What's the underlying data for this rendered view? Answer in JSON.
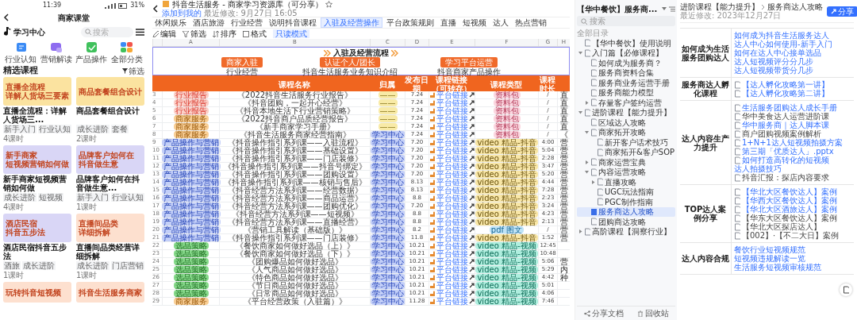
{
  "phone": {
    "status_time": "11:39",
    "battery": "31%",
    "title": "商家课堂",
    "logo": "学习中心",
    "search_placeholder": "搜索",
    "categories": [
      {
        "label": "行业认知",
        "kind": "flag"
      },
      {
        "label": "营销解读",
        "kind": "chat"
      },
      {
        "label": "产品操作",
        "kind": "check"
      },
      {
        "label": "全部分类",
        "kind": "grid"
      }
    ],
    "section_title": "精选课程",
    "filter": "筛选",
    "courses": [
      {
        "banner": [
          "直播全流程",
          "详解人货场三要素"
        ],
        "color": "#fbe3a0",
        "title": "直播全流程：详解人货场三...",
        "tags": [
          "新手入门",
          "行业认知"
        ],
        "lessons": "4课时"
      },
      {
        "banner": [
          "商品套餐组合设计"
        ],
        "color": "#fbe3a0",
        "title": "商品套餐组合设计",
        "tags": [
          "成长进阶",
          "套餐"
        ],
        "lessons": "2课时"
      },
      {
        "banner": [
          "新手商家",
          "短视频营销如何做"
        ],
        "color": "#d9d6f6",
        "title": "新手商家短视频营销如何做",
        "tags": [
          "成长进阶",
          "短视频"
        ],
        "lessons": "4课时"
      },
      {
        "banner": [
          "品牌客户如何在",
          "抖音做生意"
        ],
        "color": "#d9d6f6",
        "title": "品牌客户如何在抖音做生意...",
        "tags": [
          "新手入门",
          "行业认知"
        ],
        "lessons": "1课时"
      },
      {
        "banner": [
          "酒店民宿",
          "抖音五步法"
        ],
        "color": "#d9d6f6",
        "title": "酒店民宿抖音五步法",
        "tags": [
          "酒旅",
          "成长进阶"
        ],
        "lessons": "1课时"
      },
      {
        "banner": [
          "直播间品类",
          "详细拆解"
        ],
        "color": "#fde0cf",
        "title": "直播间品类经营详细拆解",
        "tags": [
          "成长进阶",
          "门店营销"
        ],
        "lessons": "1课时"
      }
    ],
    "more_courses": [
      {
        "banner": [
          "玩转抖音短视频"
        ],
        "color": "#fde0cf"
      },
      {
        "banner": [
          "抖音生活服务商家"
        ],
        "color": "#fde0cf"
      }
    ]
  },
  "sheet": {
    "title": "抖音生活服务 - 商家学习资源库（可分享）",
    "add_link": "添加到我的",
    "modified": "最近修改: 9月27日 16:05",
    "tabs": [
      {
        "label": "休闲娱乐",
        "selected": false
      },
      {
        "label": "酒店旅游",
        "selected": false
      },
      {
        "label": "行业经营",
        "selected": false
      },
      {
        "label": "说明抖音课程",
        "selected": false
      },
      {
        "label": "入驻及经营操作",
        "selected": true
      },
      {
        "label": "平台政策规则",
        "selected": false
      },
      {
        "label": "直播",
        "selected": false
      },
      {
        "label": "短视频",
        "selected": false
      },
      {
        "label": "达人",
        "selected": false
      },
      {
        "label": "热点营销",
        "selected": false
      }
    ],
    "toolbar": [
      "编辑",
      "筛选",
      "排序",
      "格式"
    ],
    "mode": "只读模式",
    "column_letters": [
      "A",
      "B",
      "C",
      "D",
      "E",
      "F",
      "G",
      "H"
    ],
    "flow": {
      "title": "入驻及经营流程",
      "steps": [
        {
          "label": "商家入驻",
          "caption": "行业经营"
        },
        {
          "label": "认证个人/团长",
          "caption": "抖音生活服务业务知识介绍"
        },
        {
          "label": "学习平台运营",
          "caption": "抖音商家产品操作"
        }
      ]
    },
    "columns": [
      "课程名称",
      "归属",
      "发布日期",
      "课程链接（可转存）",
      "课程类型",
      "课程时长"
    ],
    "rows": [
      {
        "num": "3",
        "category": {
          "label": "行业报告",
          "kind": "report"
        },
        "title": "《2022抖音生活服务行业报告》",
        "source": {
          "label": "——",
          "kind": "dash"
        },
        "date": "7.24",
        "link": "平台链接",
        "type": {
          "label": "资料包",
          "kind": "pack"
        },
        "duration": "/",
        "extra": "直"
      },
      {
        "num": "4",
        "category": {
          "label": "行业报告",
          "kind": "report"
        },
        "title": "《抖音团购，一起开心经营》",
        "source": {
          "label": "——",
          "kind": "dash"
        },
        "date": "7.24",
        "link": "平台链接",
        "type": {
          "label": "资料包",
          "kind": "pack"
        },
        "duration": "/",
        "extra": "直"
      },
      {
        "num": "5",
        "category": {
          "label": "行业报告",
          "kind": "report"
        },
        "title": "《抖音本地生活下行业营销策略》",
        "source": {
          "label": "——",
          "kind": "dash"
        },
        "date": "7.24",
        "link": "平台链接",
        "type": {
          "label": "资料包",
          "kind": "pack"
        },
        "duration": "/",
        "extra": "直"
      },
      {
        "num": "6",
        "category": {
          "label": "商家服务",
          "kind": "service"
        },
        "title": "《2022抖音商户品质经营报告》",
        "source": {
          "label": "——",
          "kind": "dash"
        },
        "date": "7.24",
        "link": "平台链接",
        "type": {
          "label": "资料包",
          "kind": "pack"
        },
        "duration": "/",
        "extra": "直"
      },
      {
        "num": "7",
        "category": {
          "label": "商家服务",
          "kind": "service"
        },
        "title": "《新手商家学习手册》",
        "source": {
          "label": "——",
          "kind": "dash"
        },
        "date": "7.24",
        "link": "平台链接",
        "type": {
          "label": "资料包",
          "kind": "pack"
        },
        "duration": "/",
        "extra": "直"
      },
      {
        "num": "8",
        "category": {
          "label": "商家服务",
          "kind": "service"
        },
        "title": "《抖音生活服务商家经营指南》",
        "source": {
          "label": "学习中心",
          "kind": "center"
        },
        "date": "7.24",
        "link": "平台链接",
        "type": {
          "label": "资料包",
          "kind": "pack"
        },
        "duration": "/",
        "extra": "《"
      },
      {
        "num": "9",
        "category": {
          "label": "产品操作与营销",
          "kind": "product"
        },
        "title": "《抖音操作指引系列课——入驻流程》",
        "source": {
          "label": "学习中心",
          "kind": "center"
        },
        "date": "7.20",
        "link": "平台链接",
        "type": {
          "label": "video 精品-抖音",
          "kind": "video"
        },
        "duration": "4:00",
        "extra": "营"
      },
      {
        "num": "10",
        "category": {
          "label": "产品操作与营销",
          "kind": "product"
        },
        "title": "《抖音操作指引系列课——基础设置》",
        "source": {
          "label": "学习中心",
          "kind": "center"
        },
        "date": "7.20",
        "link": "平台链接",
        "type": {
          "label": "video 精品-抖音",
          "kind": "video"
        },
        "duration": "5:04",
        "extra": "营"
      },
      {
        "num": "11",
        "category": {
          "label": "产品操作与营销",
          "kind": "product"
        },
        "title": "《抖音操作指引系列课——门店装修》",
        "source": {
          "label": "学习中心",
          "kind": "center"
        },
        "date": "7.20",
        "link": "平台链接",
        "type": {
          "label": "video 精品-抖音",
          "kind": "video"
        },
        "duration": "2:28",
        "extra": "营"
      },
      {
        "num": "12",
        "category": {
          "label": "产品操作与营销",
          "kind": "product"
        },
        "title": "《抖音操作指引系列课——抖音号绑定》",
        "source": {
          "label": "学习中心",
          "kind": "center"
        },
        "date": "7.20",
        "link": "平台链接",
        "type": {
          "label": "video 精品-抖音",
          "kind": "video"
        },
        "duration": "3:47",
        "extra": "营"
      },
      {
        "num": "13",
        "category": {
          "label": "产品操作与营销",
          "kind": "product"
        },
        "title": "《抖音操作指引系列课——团购设置》",
        "source": {
          "label": "学习中心",
          "kind": "center"
        },
        "date": "7.20",
        "link": "平台链接",
        "type": {
          "label": "video 精品-抖音",
          "kind": "video"
        },
        "duration": "5:20",
        "extra": "营"
      },
      {
        "num": "14",
        "category": {
          "label": "产品操作与营销",
          "kind": "product"
        },
        "title": "《抖音操作指引系列课——核销与售后》",
        "source": {
          "label": "学习中心",
          "kind": "center"
        },
        "date": "8.13",
        "link": "平台链接",
        "type": {
          "label": "video 精品-抖音",
          "kind": "video"
        },
        "duration": "4:44",
        "extra": "营"
      },
      {
        "num": "15",
        "category": {
          "label": "产品操作与营销",
          "kind": "product"
        },
        "title": "《抖音经营方法系列课——经营数据》",
        "source": {
          "label": "学习中心",
          "kind": "center"
        },
        "date": "8.13",
        "link": "平台链接",
        "type": {
          "label": "video 精品-抖音",
          "kind": "video"
        },
        "duration": "7:28",
        "extra": "营"
      },
      {
        "num": "16",
        "category": {
          "label": "产品操作与营销",
          "kind": "product"
        },
        "title": "《抖音经营方法系列课——商品运营》",
        "source": {
          "label": "学习中心",
          "kind": "center"
        },
        "date": "8.8",
        "link": "平台链接",
        "type": {
          "label": "video 精品-抖音",
          "kind": "video"
        },
        "duration": "2:23",
        "extra": "营"
      },
      {
        "num": "17",
        "category": {
          "label": "产品操作与营销",
          "kind": "product"
        },
        "title": "《抖音经营方法系列课——团购优化》",
        "source": {
          "label": "学习中心",
          "kind": "center"
        },
        "date": "7.20",
        "link": "平台链接",
        "type": {
          "label": "video 精品-抖音",
          "kind": "video"
        },
        "duration": "3:24",
        "extra": "营"
      },
      {
        "num": "18",
        "category": {
          "label": "产品操作与营销",
          "kind": "product"
        },
        "title": "《抖音经营方法系列课——短视频》",
        "source": {
          "label": "学习中心",
          "kind": "center"
        },
        "date": "8.8",
        "link": "平台链接",
        "type": {
          "label": "video 精品-抖音",
          "kind": "video"
        },
        "duration": "4:23",
        "extra": "营"
      },
      {
        "num": "19",
        "category": {
          "label": "产品操作与营销",
          "kind": "product"
        },
        "title": "《抖音经营方法系列课——直播经营》",
        "source": {
          "label": "学习中心",
          "kind": "center"
        },
        "date": "8.8",
        "link": "平台链接",
        "type": {
          "label": "video 精品-抖音",
          "kind": "video"
        },
        "duration": "2:13",
        "extra": "营"
      },
      {
        "num": "20",
        "category": {
          "label": "产品操作与营销",
          "kind": "product"
        },
        "title": "《营销工具解读（基础版）》",
        "source": {
          "label": "学习中心",
          "kind": "center"
        },
        "date": "8.2",
        "link": "平台链接",
        "type": {
          "label": "pdf 图文",
          "kind": "pdf"
        },
        "duration": "/",
        "extra": "营"
      },
      {
        "num": "21",
        "category": {
          "label": "产品操作与营销",
          "kind": "product"
        },
        "title": "《抖音操作指引系列课——门店装修》",
        "source": {
          "label": "学习中心",
          "kind": "center"
        },
        "date": "11.8",
        "link": "平台链接",
        "type": {
          "label": "video 精品-抖音",
          "kind": "video"
        },
        "duration": "1:52",
        "extra": "营"
      },
      {
        "num": "22",
        "category": {
          "label": "选品策略",
          "kind": "select"
        },
        "title": "《餐饮商家如何做好选品（上）》",
        "source": {
          "label": "学习中心",
          "kind": "center"
        },
        "date": "10.21",
        "link": "平台链接",
        "type": {
          "label": "video 精品-视频",
          "kind": "video2"
        },
        "duration": "12:45"
      },
      {
        "num": "23",
        "category": {
          "label": "选品策略",
          "kind": "select"
        },
        "title": "《餐饮商家如何做好选品（下）》",
        "source": {
          "label": "学习中心",
          "kind": "center"
        },
        "date": "10.21",
        "link": "平台链接",
        "type": {
          "label": "video 精品-视频",
          "kind": "video2"
        },
        "duration": "10:48"
      },
      {
        "num": "24",
        "category": {
          "label": "选品策略",
          "kind": "select"
        },
        "title": "《团购爆品如何做好选品》",
        "source": {
          "label": "学习中心",
          "kind": "center"
        },
        "date": "10.21",
        "link": "平台链接",
        "type": {
          "label": "video 精品-视频",
          "kind": "video2"
        },
        "duration": "5:06",
        "extra": "营"
      },
      {
        "num": "25",
        "category": {
          "label": "选品策略",
          "kind": "select"
        },
        "title": "《人气商品如何做好选品》",
        "source": {
          "label": "学习中心",
          "kind": "center"
        },
        "date": "10.21",
        "link": "平台链接",
        "type": {
          "label": "video 精品-视频",
          "kind": "video2"
        },
        "duration": "5:29",
        "extra": "内"
      },
      {
        "num": "26",
        "category": {
          "label": "选品策略",
          "kind": "select"
        },
        "title": "《特色商品如何做好选品》",
        "source": {
          "label": "学习中心",
          "kind": "center"
        },
        "date": "10.21",
        "link": "平台链接",
        "type": {
          "label": "video 精品-视频",
          "kind": "video2"
        },
        "duration": "4:42",
        "extra": "种"
      },
      {
        "num": "27",
        "category": {
          "label": "选品策略",
          "kind": "select"
        },
        "title": "《节日商品如何做好选品》",
        "source": {
          "label": "学习中心",
          "kind": "center"
        },
        "date": "10.21",
        "link": "平台链接",
        "type": {
          "label": "video 精品-视频",
          "kind": "video2"
        },
        "duration": "5:01"
      },
      {
        "num": "28",
        "category": {
          "label": "选品策略",
          "kind": "select"
        },
        "title": "《日常商品如何做好选品》",
        "source": {
          "label": "学习中心",
          "kind": "center"
        },
        "date": "10.21",
        "link": "平台链接",
        "type": {
          "label": "video 精品-视频",
          "kind": "video2"
        },
        "duration": "4:06"
      },
      {
        "num": "29",
        "category": {
          "label": "商家服务",
          "kind": "service"
        },
        "title": "《平台经营政策（入驻篇）》",
        "source": {
          "label": "学习中心",
          "kind": "center"
        },
        "date": "11.28",
        "link": "平台链接",
        "type": {
          "label": "video 精品-视频",
          "kind": "video2"
        },
        "duration": "7:46"
      }
    ]
  },
  "doc": {
    "sidebar": {
      "title": "【华中餐饮】服务商...",
      "search_placeholder": "搜索",
      "section": "全部目录",
      "tree": [
        {
          "label": "【华中餐饮】使用说明",
          "selected": false
        },
        {
          "label": "入门篇【必修课程】",
          "selected": false,
          "expanded": true,
          "children": [
            {
              "label": "如何成为服务商？",
              "selected": false
            },
            {
              "label": "服务商资料合集",
              "selected": false
            },
            {
              "label": "服务商业务运营手册",
              "selected": false
            },
            {
              "label": "服务商能力模型",
              "selected": false
            },
            {
              "label": "存量客户签约运营",
              "selected": false,
              "expanded": false
            }
          ]
        },
        {
          "label": "进阶课程【能力提升】",
          "selected": false,
          "expanded": true,
          "children": [
            {
              "label": "区域达人攻略",
              "selected": false
            },
            {
              "label": "商家拓开攻略",
              "selected": false,
              "expanded": true,
              "children": [
                {
                  "label": "新开客户话术技巧",
                  "selected": false
                },
                {
                  "label": "商家拓开&客户SOP",
                  "selected": false
                }
              ]
            },
            {
              "label": "商家运营宝典",
              "selected": false,
              "expanded": false
            },
            {
              "label": "内容运营攻略",
              "selected": false,
              "expanded": true,
              "children": [
                {
                  "label": "直播攻略",
                  "selected": false,
                  "expanded": false
                },
                {
                  "label": "UGC玩法指南",
                  "selected": false
                },
                {
                  "label": "PGC制作指南",
                  "selected": false
                }
              ]
            },
            {
              "label": "服务商达人攻略",
              "selected": true
            },
            {
              "label": "团购商达攻略",
              "selected": false
            }
          ]
        },
        {
          "label": "高阶课程【洞察行业】",
          "selected": false,
          "expanded": false
        }
      ],
      "footer": [
        "分享文档",
        "回收站"
      ]
    },
    "header": {
      "breadcrumb": [
        "进阶课程【能力提升】",
        "服务商达人攻略"
      ],
      "modified": "最近修改: 2023年12月27日",
      "share": "分享"
    },
    "rows": [
      {
        "label": "如何成为生活服务团购达人",
        "items": [
          {
            "text": "如何成为抖音生活服务达人",
            "kind": "bare"
          },
          {
            "text": "达人中心如何使用-新手入门",
            "kind": "bare"
          },
          {
            "text": "如何在达人中心接单选品",
            "kind": "bare"
          },
          {
            "text": "达人短视频评分分几步",
            "kind": "bare"
          },
          {
            "text": "达人短视频带货分几步",
            "kind": "bare"
          }
        ]
      },
      {
        "label": "服务商达人孵化课程",
        "items": [
          {
            "text": "【达人孵化攻略第一讲】",
            "kind": "link"
          },
          {
            "text": "【达人孵化攻略第二讲】",
            "kind": "link"
          }
        ]
      },
      {
        "label": "达人内容生产力提升",
        "items": [
          {
            "text": "生活服务团购达人成长手册",
            "kind": "link"
          },
          {
            "text": "华中美食达人运营进阶课",
            "kind": "text"
          },
          {
            "text": "华中服务商｜达人脚本课",
            "kind": "link"
          },
          {
            "text": "商户团购视频案例解析",
            "kind": "text"
          },
          {
            "text": "1+N+1达人短视频拍摄方案",
            "kind": "link"
          },
          {
            "text": "第三期「优质达人」.pptx",
            "kind": "link"
          },
          {
            "text": "如何打造高转化的短视频",
            "kind": "link"
          },
          {
            "text": "达人拍摄技巧",
            "kind": "bare"
          },
          {
            "text": "抖音汇报：探店内容要求",
            "kind": "text"
          }
        ]
      },
      {
        "label": "TOP达人案例分享",
        "items": [
          {
            "text": "【华北大区餐饮达人】案例",
            "kind": "link"
          },
          {
            "text": "【华西大区餐饮达人】案例",
            "kind": "link"
          },
          {
            "text": "【华北大区酒旅达人】案例",
            "kind": "link"
          },
          {
            "text": "【华东大区餐饮达人】案例",
            "kind": "text"
          },
          {
            "text": "【华北大区探店达人】",
            "kind": "text"
          },
          {
            "text": "【002】·【不二大日】案例",
            "kind": "text"
          }
        ]
      },
      {
        "label": "达人内容合规",
        "items": [
          {
            "text": "餐饮行业短视频规范",
            "kind": "bare"
          },
          {
            "text": "短视频违规解读一览",
            "kind": "bare"
          },
          {
            "text": "生活服务短视频审核规范",
            "kind": "bare"
          }
        ]
      }
    ]
  }
}
